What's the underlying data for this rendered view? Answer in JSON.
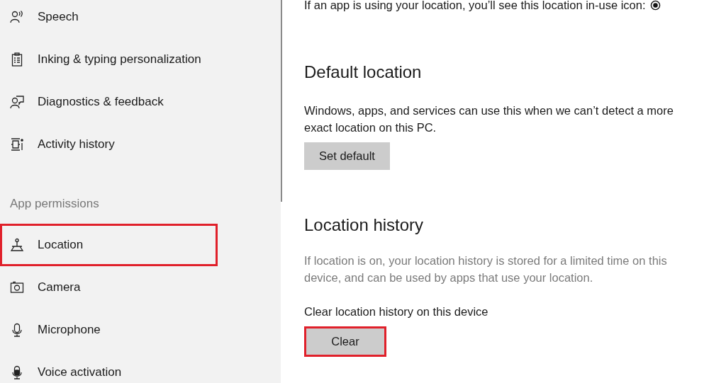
{
  "sidebar": {
    "items": [
      {
        "label": "Speech",
        "highlighted": false
      },
      {
        "label": "Inking & typing personalization",
        "highlighted": false
      },
      {
        "label": "Diagnostics & feedback",
        "highlighted": false
      },
      {
        "label": "Activity history",
        "highlighted": false
      }
    ],
    "section": {
      "title": "App permissions",
      "items": [
        {
          "label": "Location",
          "highlighted": true
        },
        {
          "label": "Camera",
          "highlighted": false
        },
        {
          "label": "Microphone",
          "highlighted": false
        },
        {
          "label": "Voice activation",
          "highlighted": false
        }
      ]
    }
  },
  "main": {
    "in_use_note": "If an app is using your location, you’ll see this location in-use icon:",
    "default_location": {
      "heading": "Default location",
      "description": "Windows, apps, and services can use this when we can’t detect a more exact location on this PC.",
      "button": {
        "label": "Set default",
        "highlighted": false
      }
    },
    "location_history": {
      "heading": "Location history",
      "description": "If location is on, your location history is stored for a limited time on this device, and can be used by apps that use your location.",
      "description_disabled": true,
      "clear_label": "Clear location history on this device",
      "button": {
        "label": "Clear",
        "highlighted": true
      }
    }
  }
}
